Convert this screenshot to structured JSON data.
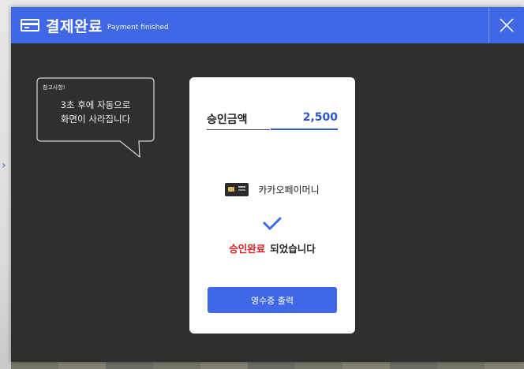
{
  "dialog": {
    "title": "결제완료",
    "subtitle": "Payment finished"
  },
  "note": {
    "label": "참고사항!",
    "line1": "3초 후에 자동으로",
    "line2": "화면이 사라집니다"
  },
  "payment": {
    "amount_label": "승인금액",
    "amount_value": "2,500",
    "method": "카카오페이머니",
    "status_highlight": "승인완료",
    "status_rest": "되었습니다",
    "receipt_button": "영수증 출력"
  },
  "colors": {
    "accent": "#3f67e6",
    "amount": "#2d57cf",
    "status": "#d62020",
    "modal_bg": "#2f2f2f"
  },
  "icons": {
    "title": "credit-card-icon",
    "close": "close-icon",
    "method": "payment-card-icon",
    "status": "check-icon"
  }
}
